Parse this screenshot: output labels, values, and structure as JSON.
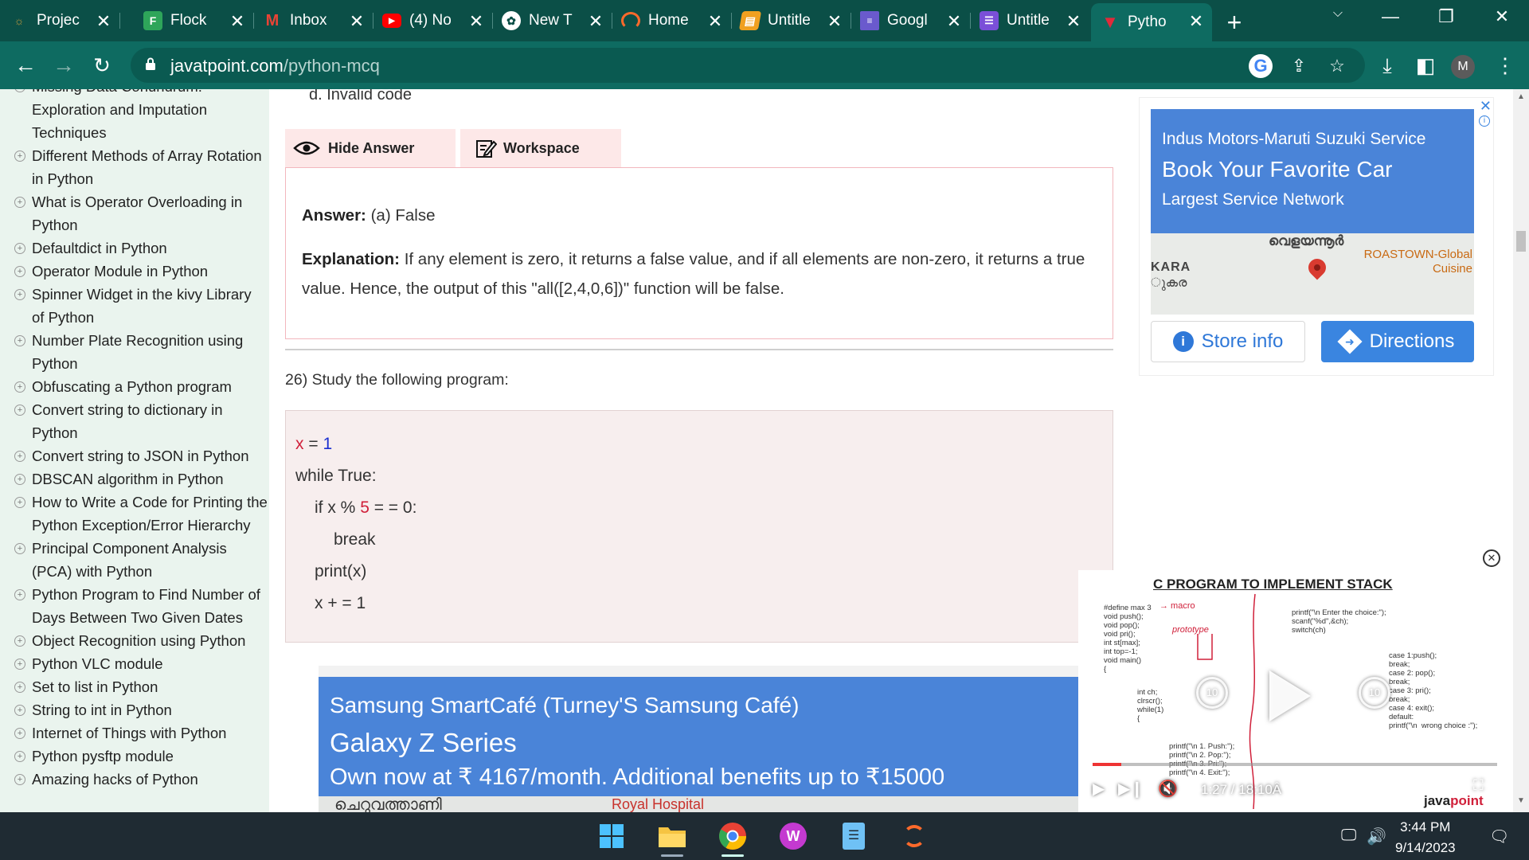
{
  "tabs": [
    {
      "title": "Projec",
      "favicon": "project-icon",
      "color": "#c39a3e"
    },
    {
      "title": "Flock",
      "favicon": "flock-icon",
      "color": "#2ea55a"
    },
    {
      "title": "Inbox",
      "favicon": "gmail-icon",
      "color": "#ea4335"
    },
    {
      "title": "(4) No",
      "favicon": "youtube-icon",
      "color": "#ff0000"
    },
    {
      "title": "New T",
      "favicon": "chatgpt-icon",
      "color": "#ffffff"
    },
    {
      "title": "Home",
      "favicon": "home-spinner-icon",
      "color": "#ff6a2b"
    },
    {
      "title": "Untitle",
      "favicon": "notebook-icon",
      "color": "#f0a020"
    },
    {
      "title": "Googl",
      "favicon": "google-docs-icon",
      "color": "#6a5acd"
    },
    {
      "title": "Untitle",
      "favicon": "google-forms-icon",
      "color": "#7a4fd8"
    },
    {
      "title": "Pytho",
      "favicon": "javatpoint-icon",
      "color": "#e02a3a",
      "active": true
    }
  ],
  "toolbar": {
    "url_host": "javatpoint.com",
    "url_path": "/python-mcq",
    "profile_initial": "M"
  },
  "sidebar": {
    "items": [
      "Missing Data Conundrum: Exploration and Imputation Techniques",
      "Different Methods of Array Rotation in Python",
      "What is Operator Overloading in Python",
      "Defaultdict in Python",
      "Operator Module in Python",
      "Spinner Widget in the kivy Library of Python",
      "Number Plate Recognition using Python",
      "Obfuscating a Python program",
      "Convert string to dictionary in Python",
      "Convert string to JSON in Python",
      "DBSCAN algorithm in Python",
      "How to Write a Code for Printing the Python Exception/Error Hierarchy",
      "Principal Component Analysis (PCA) with Python",
      "Python Program to Find Number of Days Between Two Given Dates",
      "Object Recognition using Python",
      "Python VLC module",
      "Set to list in Python",
      "String to int in Python",
      "Internet of Things with Python",
      "Python pysftp module",
      "Amazing hacks of Python"
    ]
  },
  "question": {
    "prev_option_d": "d. Invalid code",
    "hide_answer_label": "Hide Answer",
    "workspace_label": "Workspace",
    "answer_label": "Answer:",
    "answer_value": "(a) False",
    "explanation_label": "Explanation:",
    "explanation_text": "If any element is zero, it returns a false value, and if all elements are non-zero, it returns a true value. Hence, the output of this \"all([2,4,0,6])\" function will be false.",
    "next_question": "26) Study the following program:"
  },
  "code": {
    "x_assign_var": "x",
    "x_assign_op": " = ",
    "x_assign_val": "1",
    "while_line": "while True:",
    "if_prefix": "if x % ",
    "if_num": "5",
    "if_suffix": " = = 0:",
    "break_line": "break",
    "print_line": "print(x)",
    "incr_line": "x + = 1"
  },
  "ad_bottom": {
    "line1": "Samsung SmartCafé (Turney'S Samsung Café)",
    "line2": "Galaxy Z Series",
    "line3": "Own now at ₹ 4167/month. Additional benefits up to ₹15000",
    "map_label_1": "ചെറുവത്താണി",
    "map_label_2": "Royal Hospital"
  },
  "ad_right": {
    "line1": "Indus Motors-Maruti Suzuki Service",
    "line2": "Book Your Favorite Car",
    "line3": "Largest Service Network",
    "map_town": "വെളയന്നൂർ",
    "map_area": "KARA",
    "map_area_local": "ുകര",
    "map_poi": "ROASTOWN-Global Cuisine",
    "store_info": "Store info",
    "directions": "Directions"
  },
  "video": {
    "title": "C PROGRAM TO IMPLEMENT STACK",
    "time": "1:27 / 18:10Â",
    "progress": 0.07,
    "logo_a": "java",
    "logo_b": "point",
    "skip_back": "10",
    "skip_fwd": "10",
    "code_left": "#define max 3\nvoid push();\nvoid pop();\nvoid pri();\nint st[max];\nint top=-1;\nvoid main()\n{",
    "code_mid": "int ch;\nclrscr();\nwhile(1)\n{",
    "code_bottom": "printf(\"\\n 1. Push:\");\nprintf(\"\\n 2. Pop:\");\nprintf(\"\\n 3. Pri:\");\nprintf(\"\\n 4. Exit:\");",
    "code_right_top": "printf(\"\\n Enter the choice:\");\nscanf(\"%d\",&ch);\nswitch(ch)",
    "code_right_cases": "case 1:push();\nbreak;\ncase 2: pop();\nbreak;\ncase 3: pri();\nbreak;\ncase 4: exit();\ndefault:\nprintf(\"\\n  wrong choice :\");",
    "annot_macro": "→ macro",
    "annot_proto": "prototype"
  },
  "taskbar": {
    "time": "3:44 PM",
    "date": "9/14/2023"
  }
}
